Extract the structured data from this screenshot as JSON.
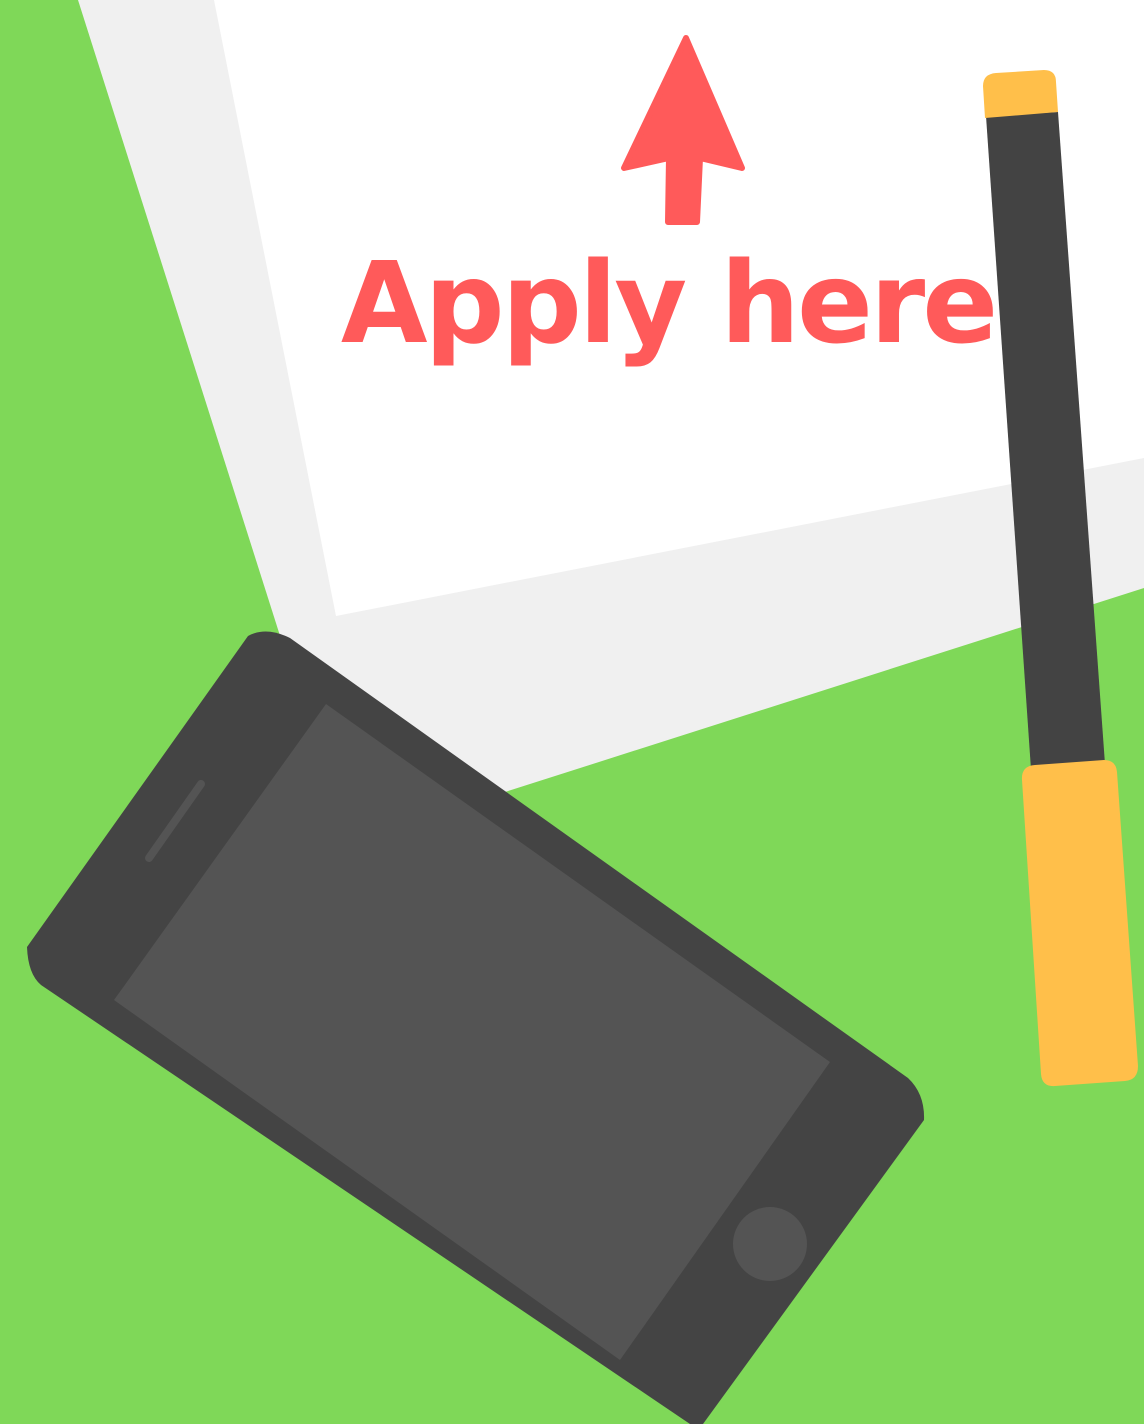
{
  "cta": {
    "label": "Apply here",
    "icon": "arrow-up-icon",
    "color": "#ff5a5a"
  },
  "colors": {
    "background": "#7fd858",
    "paper_shadow": "#f0f0f0",
    "paper": "#ffffff",
    "phone_body": "#444444",
    "phone_screen": "#545454",
    "pen_body": "#434343",
    "pen_cap": "#ffbf4a"
  },
  "objects": {
    "paper": "paper-sheet",
    "phone": "smartphone-icon",
    "pen": "pen-icon"
  }
}
